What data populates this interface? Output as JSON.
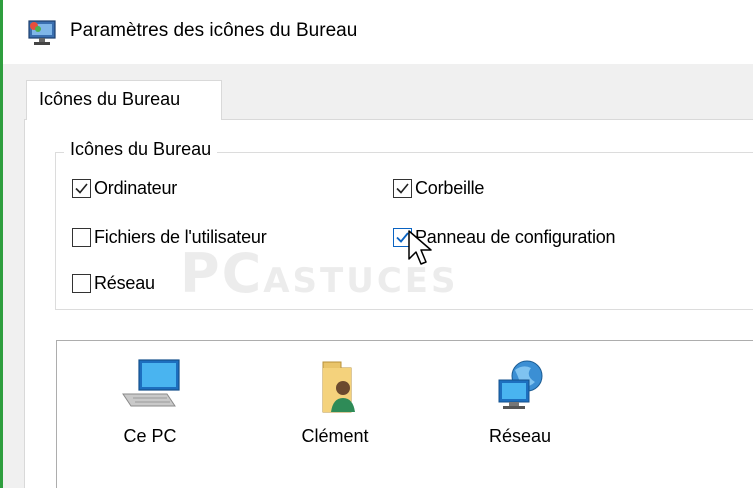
{
  "window": {
    "title": "Paramètres des icônes du Bureau"
  },
  "tabs": [
    {
      "label": "Icônes du Bureau",
      "active": true
    }
  ],
  "group": {
    "legend": "Icônes du Bureau",
    "checkboxes": {
      "ordinateur": {
        "label": "Ordinateur",
        "checked": true
      },
      "corbeille": {
        "label": "Corbeille",
        "checked": true
      },
      "fichiers": {
        "label": "Fichiers de l'utilisateur",
        "checked": false
      },
      "panneau": {
        "label": "Panneau de configuration",
        "checked": true
      },
      "reseau": {
        "label": "Réseau",
        "checked": false
      }
    }
  },
  "watermark": {
    "big": "PC",
    "small": "ASTUCES"
  },
  "preview_icons": [
    {
      "label": "Ce PC",
      "icon": "computer-icon"
    },
    {
      "label": "Clément",
      "icon": "user-folder-icon"
    },
    {
      "label": "Réseau",
      "icon": "network-icon"
    }
  ],
  "colors": {
    "accent_border": "#2e9e3e",
    "check_highlight": "#0a63c2"
  }
}
